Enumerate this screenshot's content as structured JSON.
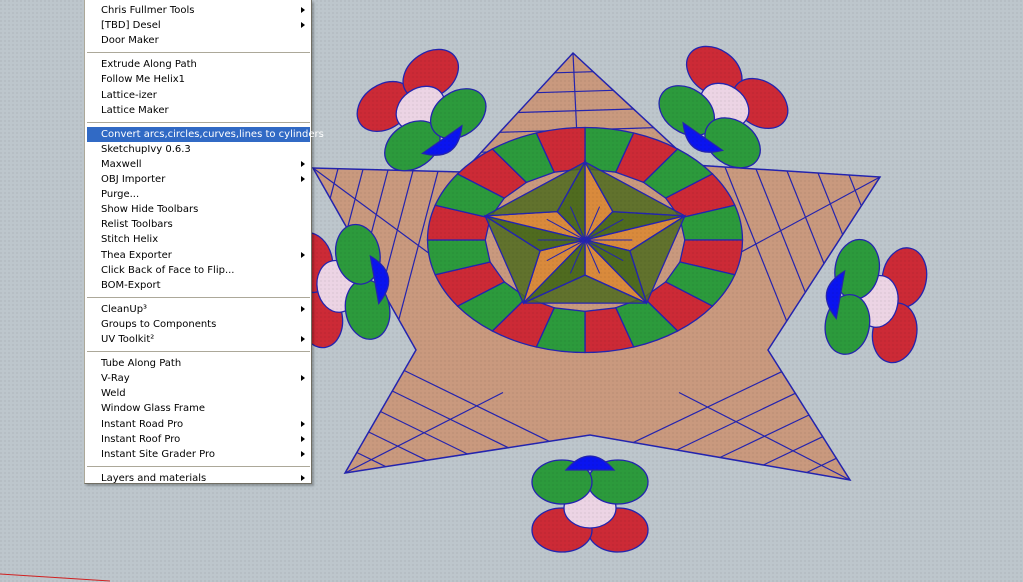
{
  "menu": {
    "sections": [
      [
        {
          "label": "Chris Fullmer Tools",
          "submenu": true
        },
        {
          "label": "[TBD] Desel",
          "submenu": true
        },
        {
          "label": "Door Maker",
          "submenu": false
        }
      ],
      [
        {
          "label": "Extrude Along Path",
          "submenu": false
        },
        {
          "label": "Follow Me Helix1",
          "submenu": false
        },
        {
          "label": "Lattice-izer",
          "submenu": false
        },
        {
          "label": "Lattice Maker",
          "submenu": false
        }
      ],
      [
        {
          "label": "Convert arcs,circles,curves,lines to cylinders",
          "submenu": false,
          "highlighted": true
        },
        {
          "label": "SketchupIvy 0.6.3",
          "submenu": false
        },
        {
          "label": "Maxwell",
          "submenu": true
        },
        {
          "label": "OBJ Importer",
          "submenu": true
        },
        {
          "label": "Purge...",
          "submenu": false
        },
        {
          "label": "Show Hide Toolbars",
          "submenu": false
        },
        {
          "label": "Relist Toolbars",
          "submenu": false
        },
        {
          "label": "Stitch Helix",
          "submenu": false
        },
        {
          "label": "Thea Exporter",
          "submenu": true
        },
        {
          "label": "Click Back of Face to Flip...",
          "submenu": false
        },
        {
          "label": "BOM-Export",
          "submenu": false
        }
      ],
      [
        {
          "label": "CleanUp³",
          "submenu": true
        },
        {
          "label": "Groups to Components",
          "submenu": false
        },
        {
          "label": "UV Toolkit²",
          "submenu": true
        }
      ],
      [
        {
          "label": "Tube Along Path",
          "submenu": false
        },
        {
          "label": "V-Ray",
          "submenu": true
        },
        {
          "label": "Weld",
          "submenu": false
        },
        {
          "label": "Window Glass Frame",
          "submenu": false
        },
        {
          "label": "Instant Road Pro",
          "submenu": true
        },
        {
          "label": "Instant Roof Pro",
          "submenu": true
        },
        {
          "label": "Instant Site Grader Pro",
          "submenu": true
        }
      ],
      [
        {
          "label": "Layers and materials",
          "submenu": true
        }
      ]
    ]
  },
  "colors": {
    "background": "#bdc6cc",
    "menu_highlight": "#316ac5",
    "tan": "#c9997e",
    "orange": "#d98a3c",
    "dark_green": "#4f6b1f",
    "red": "#cc2a36",
    "green": "#2c9a3c",
    "blue": "#0a14f0",
    "pink": "#ecd4e4",
    "edge": "#2424b0"
  }
}
